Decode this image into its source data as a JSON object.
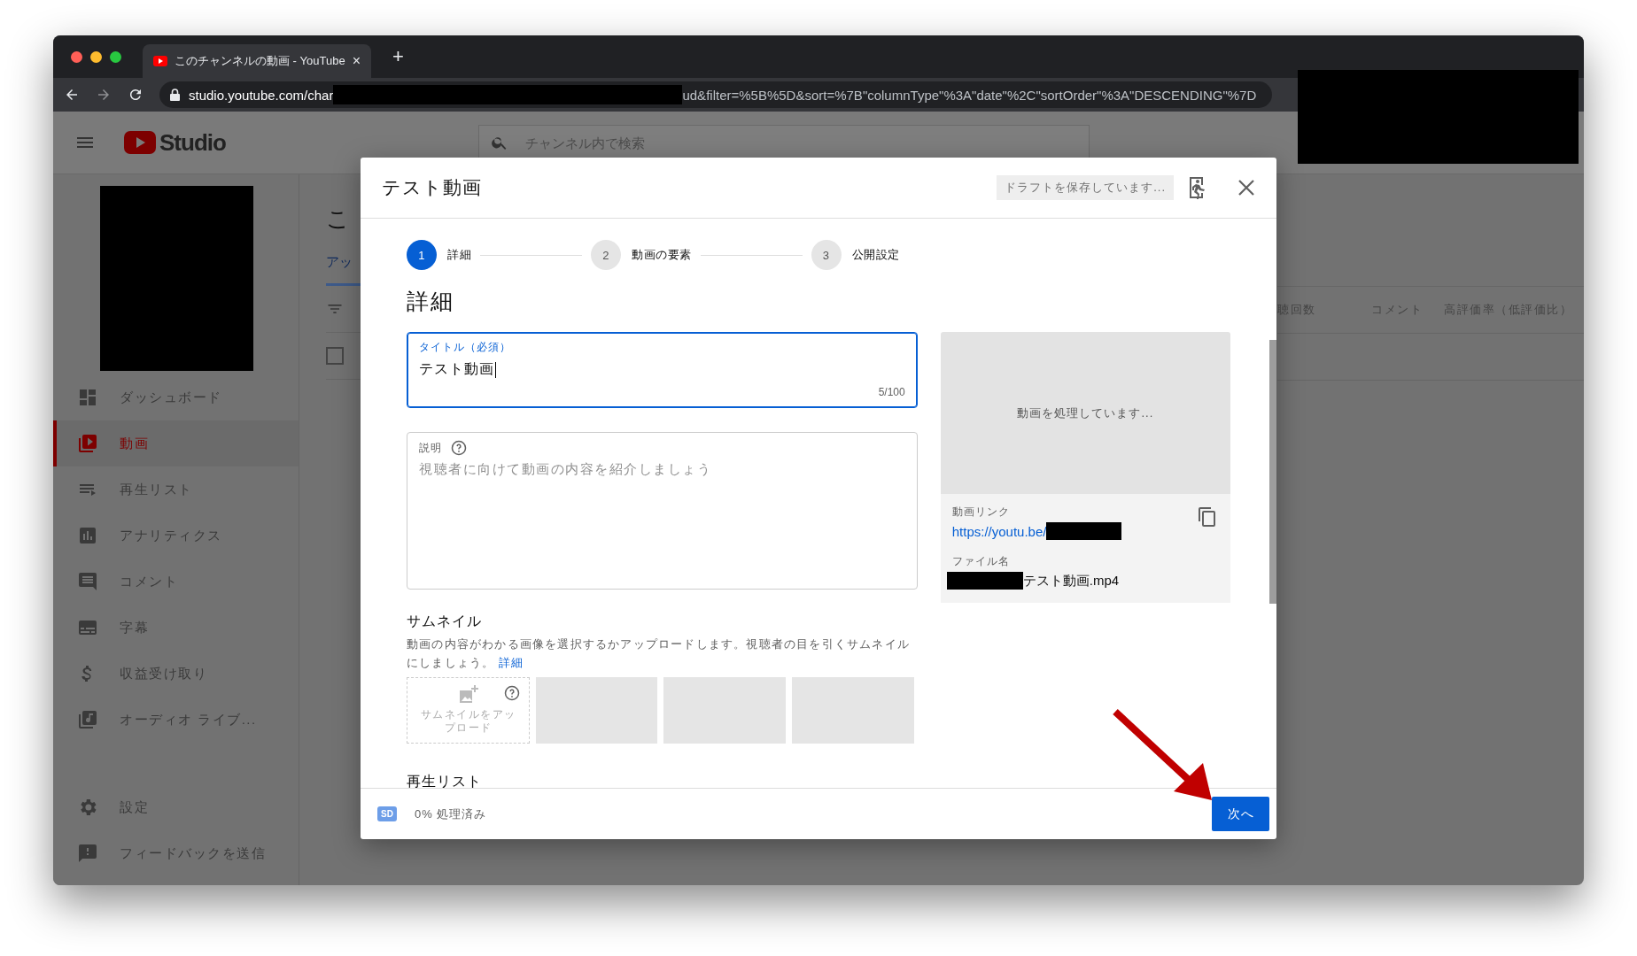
{
  "browser": {
    "tab": {
      "title": "このチャンネルの動画 - YouTube",
      "close": "×"
    },
    "new_tab": "+",
    "url": {
      "start": "studio.youtube.com/char",
      "end": "ud&filter=%5B%5D&sort=%7B\"columnType\"%3A\"date\"%2C\"sortOrder\"%3A\"DESCENDING\"%7D"
    }
  },
  "app": {
    "logo": "Studio",
    "search": {
      "placeholder": "チャンネル内で検索"
    }
  },
  "sidebar": {
    "items": [
      {
        "kind": "dashboard",
        "label": "ダッシュボード",
        "selected": false
      },
      {
        "kind": "videos",
        "label": "動画",
        "selected": true
      },
      {
        "kind": "playlists",
        "label": "再生リスト",
        "selected": false
      },
      {
        "kind": "analytics",
        "label": "アナリティクス",
        "selected": false
      },
      {
        "kind": "comments",
        "label": "コメント",
        "selected": false
      },
      {
        "kind": "subtitles",
        "label": "字幕",
        "selected": false
      },
      {
        "kind": "monetization",
        "label": "収益受け取り",
        "selected": false
      },
      {
        "kind": "audio",
        "label": "オーディオ ライブ...",
        "selected": false
      }
    ],
    "bottom_items": [
      {
        "kind": "settings",
        "label": "設定",
        "selected": false
      },
      {
        "kind": "feedback",
        "label": "フィードバックを送信",
        "selected": false
      }
    ]
  },
  "page": {
    "title": "こ",
    "tab": "アッ",
    "select_all": {
      "checked": false
    },
    "columns": [
      "聴回数",
      "コメント",
      "高評価率（低評価比）"
    ]
  },
  "dialog": {
    "title": "テスト動画",
    "draft_status": "ドラフトを保存しています...",
    "steps": [
      {
        "number": "1",
        "label": "詳細",
        "selected": true
      },
      {
        "number": "2",
        "label": "動画の要素",
        "selected": false
      },
      {
        "number": "3",
        "label": "公開設定",
        "selected": false
      }
    ],
    "heading": "詳細",
    "title_field": {
      "label": "タイトル（必須）",
      "value": "テスト動画",
      "counter": "5/100",
      "focused": true
    },
    "description_field": {
      "label": "説明",
      "placeholder": "視聴者に向けて動画の内容を紹介しましょう",
      "focused": false
    },
    "thumbnail": {
      "heading": "サムネイル",
      "text": "動画の内容がわかる画像を選択するかアップロードします。視聴者の目を引くサムネイルにしましょう。",
      "link": "詳細",
      "upload": "サムネイルをアップロード"
    },
    "next_section": "再生リスト",
    "preview": {
      "status": "動画を処理しています...",
      "link_label": "動画リンク",
      "link": "https://youtu.be/",
      "filename_label": "ファイル名",
      "filename": "テスト動画.mp4"
    },
    "footer": {
      "badge": "SD",
      "progress": "0% 処理済み",
      "next_button": "次へ"
    }
  }
}
